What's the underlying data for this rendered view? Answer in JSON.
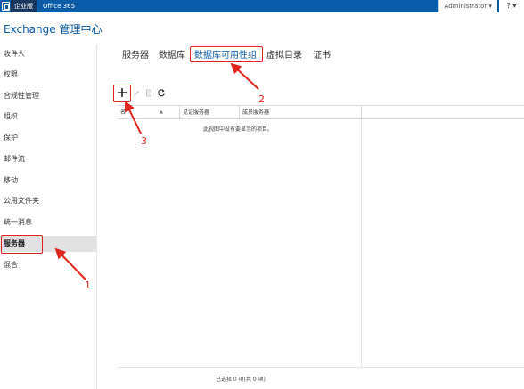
{
  "topbar": {
    "tab_enterprise": "企业版",
    "tab_office": "Office 365",
    "user": "Administrator",
    "user_caret": "▾",
    "help": "? ▾"
  },
  "app_title": "Exchange 管理中心",
  "sidebar": {
    "items": [
      {
        "label": "收件人"
      },
      {
        "label": "权限"
      },
      {
        "label": "合规性管理"
      },
      {
        "label": "组织"
      },
      {
        "label": "保护"
      },
      {
        "label": "邮件流"
      },
      {
        "label": "移动"
      },
      {
        "label": "公用文件夹"
      },
      {
        "label": "统一消息"
      },
      {
        "label": "服务器",
        "active": true
      },
      {
        "label": "混合"
      }
    ]
  },
  "tabs": [
    {
      "label": "服务器"
    },
    {
      "label": "数据库"
    },
    {
      "label": "数据库可用性组",
      "active": true
    },
    {
      "label": "虚拟目录"
    },
    {
      "label": "证书"
    }
  ],
  "toolbar": {
    "add_icon": "plus-icon",
    "edit_icon": "pencil-icon",
    "delete_icon": "trash-icon",
    "refresh_icon": "refresh-icon"
  },
  "grid": {
    "columns": [
      "名",
      "见证服务器",
      "成员服务器"
    ],
    "empty_message": "此视图中没有要显示的项目。"
  },
  "status": "已选择 0 项(共 0 项)",
  "annotations": {
    "n1": "1",
    "n2": "2",
    "n3": "3",
    "color": "#e0261c"
  }
}
